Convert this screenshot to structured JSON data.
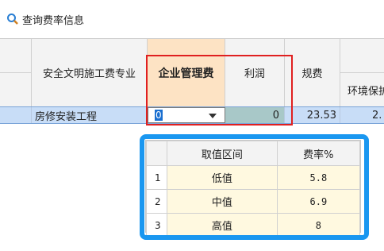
{
  "window": {
    "title": "查询费率信息",
    "icon": "search-icon"
  },
  "grid": {
    "headers": {
      "specialty": "安全文明施工费专业",
      "mgmt_fee": "企业管理费",
      "profit": "利润",
      "regulation_fee": "规费",
      "env_protect_partial": "环境保护"
    },
    "row": {
      "specialty": "房修安装工程",
      "mgmt_fee_value": "0",
      "profit_value": "0",
      "regulation_value": "23.53",
      "env_partial_value": "2."
    }
  },
  "popup": {
    "columns": [
      "",
      "取值区间",
      "费率%"
    ],
    "rows": [
      {
        "index": "1",
        "range": "低值",
        "rate": "5.8"
      },
      {
        "index": "2",
        "range": "中值",
        "rate": "6.9"
      },
      {
        "index": "3",
        "range": "高值",
        "rate": "8"
      }
    ]
  },
  "colors": {
    "highlight_red": "#e02020",
    "highlight_blue": "#1a97f0",
    "selected_row": "#c8ddf7",
    "mgmt_header": "#fde3c4",
    "profit_cell": "#a8c8c8",
    "popup_cell": "#fff9e0"
  }
}
